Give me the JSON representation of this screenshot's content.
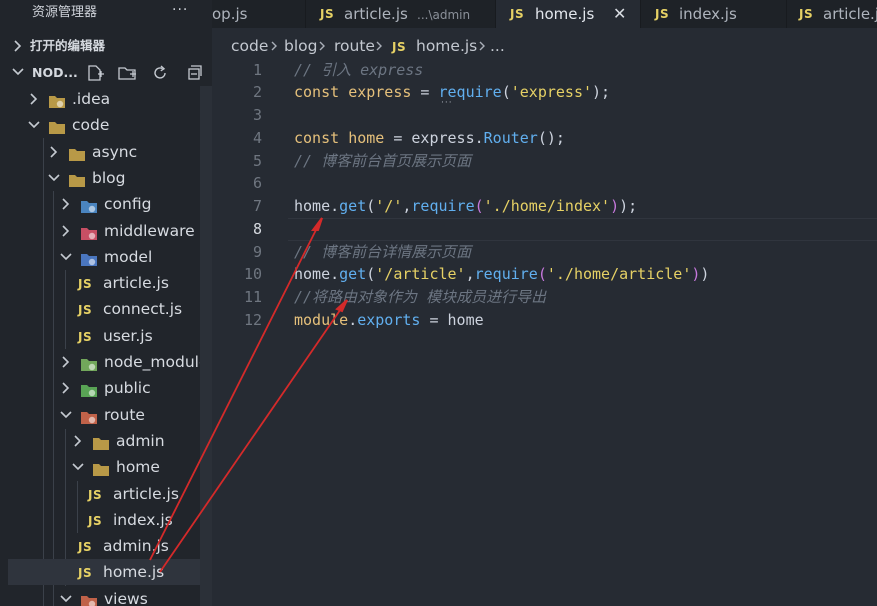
{
  "sidebar": {
    "title": "资源管理器",
    "more": "···",
    "open_editors": "打开的编辑器",
    "workspace": "NOD...",
    "tree": [
      {
        "label": ".idea",
        "kind": "folder-special",
        "color": "#c9a64a",
        "expanded": false
      },
      {
        "label": "code",
        "kind": "folder",
        "expanded": true
      },
      {
        "label": "async",
        "kind": "folder",
        "expanded": false
      },
      {
        "label": "blog",
        "kind": "folder",
        "expanded": true
      },
      {
        "label": "config",
        "kind": "folder-special",
        "color": "#4f8fcf",
        "expanded": false
      },
      {
        "label": "middleware",
        "kind": "folder-special",
        "color": "#d9546a",
        "expanded": false
      },
      {
        "label": "model",
        "kind": "folder-special",
        "color": "#4f7fcf",
        "expanded": true
      },
      {
        "label": "article.js",
        "kind": "js"
      },
      {
        "label": "connect.js",
        "kind": "js"
      },
      {
        "label": "user.js",
        "kind": "js"
      },
      {
        "label": "node_modules",
        "kind": "folder-special",
        "color": "#7bb661",
        "expanded": false
      },
      {
        "label": "public",
        "kind": "folder-special",
        "color": "#5fb35a",
        "expanded": false
      },
      {
        "label": "route",
        "kind": "folder-special",
        "color": "#d1694c",
        "expanded": true
      },
      {
        "label": "admin",
        "kind": "folder",
        "expanded": false
      },
      {
        "label": "home",
        "kind": "folder",
        "expanded": true
      },
      {
        "label": "article.js",
        "kind": "js"
      },
      {
        "label": "index.js",
        "kind": "js"
      },
      {
        "label": "admin.js",
        "kind": "js"
      },
      {
        "label": "home.js",
        "kind": "js"
      },
      {
        "label": "views",
        "kind": "folder-special",
        "color": "#d1694c",
        "expanded": true
      }
    ]
  },
  "tabs": [
    {
      "label": "op.js",
      "desc": ""
    },
    {
      "label": "article.js",
      "desc": "...\\admin"
    },
    {
      "label": "home.js",
      "desc": "",
      "close": "✕"
    },
    {
      "label": "index.js",
      "desc": ""
    },
    {
      "label": "article.js",
      "desc": ""
    }
  ],
  "breadcrumbs": [
    "code",
    "blog",
    "route",
    "home.js",
    "..."
  ],
  "editor": {
    "line_numbers": [
      "1",
      "2",
      "3",
      "4",
      "5",
      "6",
      "7",
      "8",
      "9",
      "10",
      "11",
      "12"
    ],
    "current_line": 8,
    "lines": [
      [
        {
          "t": "// 引入 express",
          "c": "com"
        }
      ],
      [
        {
          "t": "const ",
          "c": "kw"
        },
        {
          "t": "express",
          "c": "var"
        },
        {
          "t": " = ",
          "c": "txt"
        },
        {
          "t": "require",
          "c": "fn"
        },
        {
          "t": "(",
          "c": "txt"
        },
        {
          "t": "'express'",
          "c": "str"
        },
        {
          "t": ");",
          "c": "txt"
        }
      ],
      [],
      [
        {
          "t": "const ",
          "c": "kw"
        },
        {
          "t": "home",
          "c": "var"
        },
        {
          "t": " = ",
          "c": "txt"
        },
        {
          "t": "express",
          "c": "txt"
        },
        {
          "t": ".",
          "c": "txt"
        },
        {
          "t": "Router",
          "c": "fn"
        },
        {
          "t": "();",
          "c": "txt"
        }
      ],
      [
        {
          "t": "// 博客前台首页展示页面",
          "c": "com"
        }
      ],
      [],
      [
        {
          "t": "home",
          "c": "txt"
        },
        {
          "t": ".",
          "c": "txt"
        },
        {
          "t": "get",
          "c": "fn"
        },
        {
          "t": "(",
          "c": "txt"
        },
        {
          "t": "'/'",
          "c": "str"
        },
        {
          "t": ",",
          "c": "txt"
        },
        {
          "t": "require",
          "c": "fn"
        },
        {
          "t": "(",
          "c": "pun"
        },
        {
          "t": "'./home/index'",
          "c": "str"
        },
        {
          "t": ")",
          "c": "pun"
        },
        {
          "t": ");",
          "c": "txt"
        }
      ],
      [],
      [
        {
          "t": "// 博客前台详情展示页面",
          "c": "com"
        }
      ],
      [
        {
          "t": "home",
          "c": "txt"
        },
        {
          "t": ".",
          "c": "txt"
        },
        {
          "t": "get",
          "c": "fn"
        },
        {
          "t": "(",
          "c": "txt"
        },
        {
          "t": "'/article'",
          "c": "str"
        },
        {
          "t": ",",
          "c": "txt"
        },
        {
          "t": "require",
          "c": "fn"
        },
        {
          "t": "(",
          "c": "pun"
        },
        {
          "t": "'./home/article'",
          "c": "str"
        },
        {
          "t": ")",
          "c": "pun"
        },
        {
          "t": ")",
          "c": "txt"
        }
      ],
      [
        {
          "t": "//将路由对象作为 模块成员进行导出",
          "c": "com"
        }
      ],
      [
        {
          "t": "module",
          "c": "var"
        },
        {
          "t": ".",
          "c": "txt"
        },
        {
          "t": "exports",
          "c": "fn"
        },
        {
          "t": " = ",
          "c": "txt"
        },
        {
          "t": "home",
          "c": "txt"
        }
      ]
    ]
  },
  "colors": {
    "annotation_arrow": "#d42a2a",
    "js_icon": "#e6d165",
    "background": "#262b33"
  }
}
